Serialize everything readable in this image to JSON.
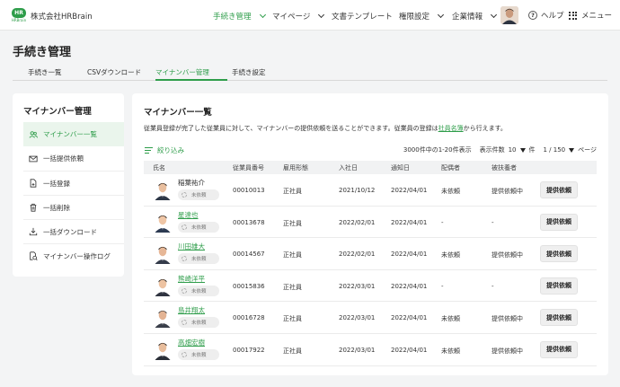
{
  "header": {
    "logo_text": "HR",
    "logo_sub": "HRBrain",
    "company": "株式会社HRBrain",
    "nav": [
      {
        "label": "手続き管理",
        "active": true
      },
      {
        "label": "マイページ"
      },
      {
        "label": "文書テンプレート"
      },
      {
        "label": "権限設定"
      },
      {
        "label": "企業情報"
      }
    ],
    "help": "ヘルプ",
    "menu": "メニュー"
  },
  "page_title": "手続き管理",
  "tabs": [
    "手続き一覧",
    "CSVダウンロード",
    "マイナンバー管理",
    "手続き設定"
  ],
  "sidebar": {
    "title": "マイナンバー管理",
    "items": [
      {
        "label": "マイナンバー一覧",
        "icon": "users-icon",
        "active": true
      },
      {
        "label": "一括提供依頼",
        "icon": "mail-icon"
      },
      {
        "label": "一括登録",
        "icon": "file-plus-icon"
      },
      {
        "label": "一括削除",
        "icon": "trash-icon"
      },
      {
        "label": "一括ダウンロード",
        "icon": "download-icon"
      },
      {
        "label": "マイナンバー操作ログ",
        "icon": "log-icon"
      }
    ]
  },
  "main": {
    "title": "マイナンバー一覧",
    "desc_pre": "従業員登録が完了した従業員に対して、マイナンバーの提供依頼を送ることができます。従業員の登録は",
    "desc_link": "社員名簿",
    "desc_post": "から行えます。",
    "filter": "絞り込み",
    "count": "3000件中の1-20件表示",
    "per_page_label": "表示件数",
    "per_page": "10",
    "per_page_unit": "件",
    "page": "1 / 150",
    "page_unit": "ページ",
    "columns": [
      "氏名",
      "従業員番号",
      "雇用形態",
      "入社日",
      "通知日",
      "配偶者",
      "被扶養者"
    ],
    "status_chip": "未依頼",
    "action": "提供依頼",
    "rows": [
      {
        "name": "稲葉祐介",
        "link": false,
        "emp_no": "00010013",
        "type": "正社員",
        "join": "2021/10/12",
        "notice": "2022/04/01",
        "spouse": "未依頼",
        "dependent": "提供依頼中"
      },
      {
        "name": "星達也",
        "link": true,
        "emp_no": "00013678",
        "type": "正社員",
        "join": "2022/02/01",
        "notice": "2022/04/01",
        "spouse": "-",
        "dependent": "-"
      },
      {
        "name": "川田雄大",
        "link": true,
        "emp_no": "00014567",
        "type": "正社員",
        "join": "2022/02/01",
        "notice": "2022/04/01",
        "spouse": "未依頼",
        "dependent": "提供依頼中"
      },
      {
        "name": "熊崎洋平",
        "link": true,
        "emp_no": "00015836",
        "type": "正社員",
        "join": "2022/03/01",
        "notice": "2022/04/01",
        "spouse": "-",
        "dependent": "-"
      },
      {
        "name": "島井翔太",
        "link": true,
        "emp_no": "00016728",
        "type": "正社員",
        "join": "2022/03/01",
        "notice": "2022/04/01",
        "spouse": "未依頼",
        "dependent": "提供依頼中"
      },
      {
        "name": "高畑宏樹",
        "link": true,
        "emp_no": "00017922",
        "type": "正社員",
        "join": "2022/03/01",
        "notice": "2022/04/01",
        "spouse": "未依頼",
        "dependent": "提供依頼中"
      }
    ]
  },
  "colors": {
    "accent": "#2e9d4a"
  }
}
